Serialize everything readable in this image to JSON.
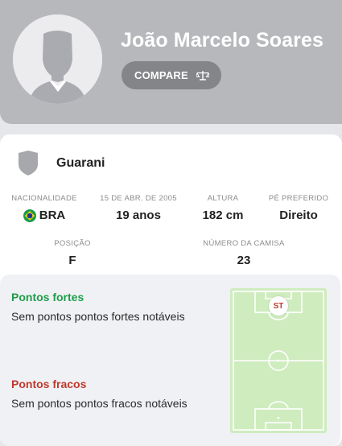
{
  "player": {
    "name": "João Marcelo Soares",
    "compare_label": "COMPARE"
  },
  "team": {
    "name": "Guarani"
  },
  "stats": {
    "nationality": {
      "label": "NACIONALIDADE",
      "value": "BRA"
    },
    "birth": {
      "label": "15 DE ABR. DE 2005",
      "value": "19 anos"
    },
    "height": {
      "label": "ALTURA",
      "value": "182 cm"
    },
    "foot": {
      "label": "PÉ PREFERIDO",
      "value": "Direito"
    },
    "position": {
      "label": "POSIÇÃO",
      "value": "F"
    },
    "shirt": {
      "label": "NÚMERO DA CAMISA",
      "value": "23"
    }
  },
  "strengths": {
    "title": "Pontos fortes",
    "text": "Sem pontos pontos fortes notáveis",
    "color": "#1e9e4a"
  },
  "weaknesses": {
    "title": "Pontos fracos",
    "text": "Sem pontos pontos fracos notáveis",
    "color": "#c0392b"
  },
  "pitch": {
    "position_badge": "ST",
    "colors": {
      "field": "#cfecbf",
      "lines": "#ffffff",
      "badge_text": "#c0392b"
    }
  },
  "icons": {
    "avatar": "player-silhouette-icon",
    "compare": "scale-icon",
    "team": "shield-icon",
    "flag": "brazil-flag-icon"
  }
}
